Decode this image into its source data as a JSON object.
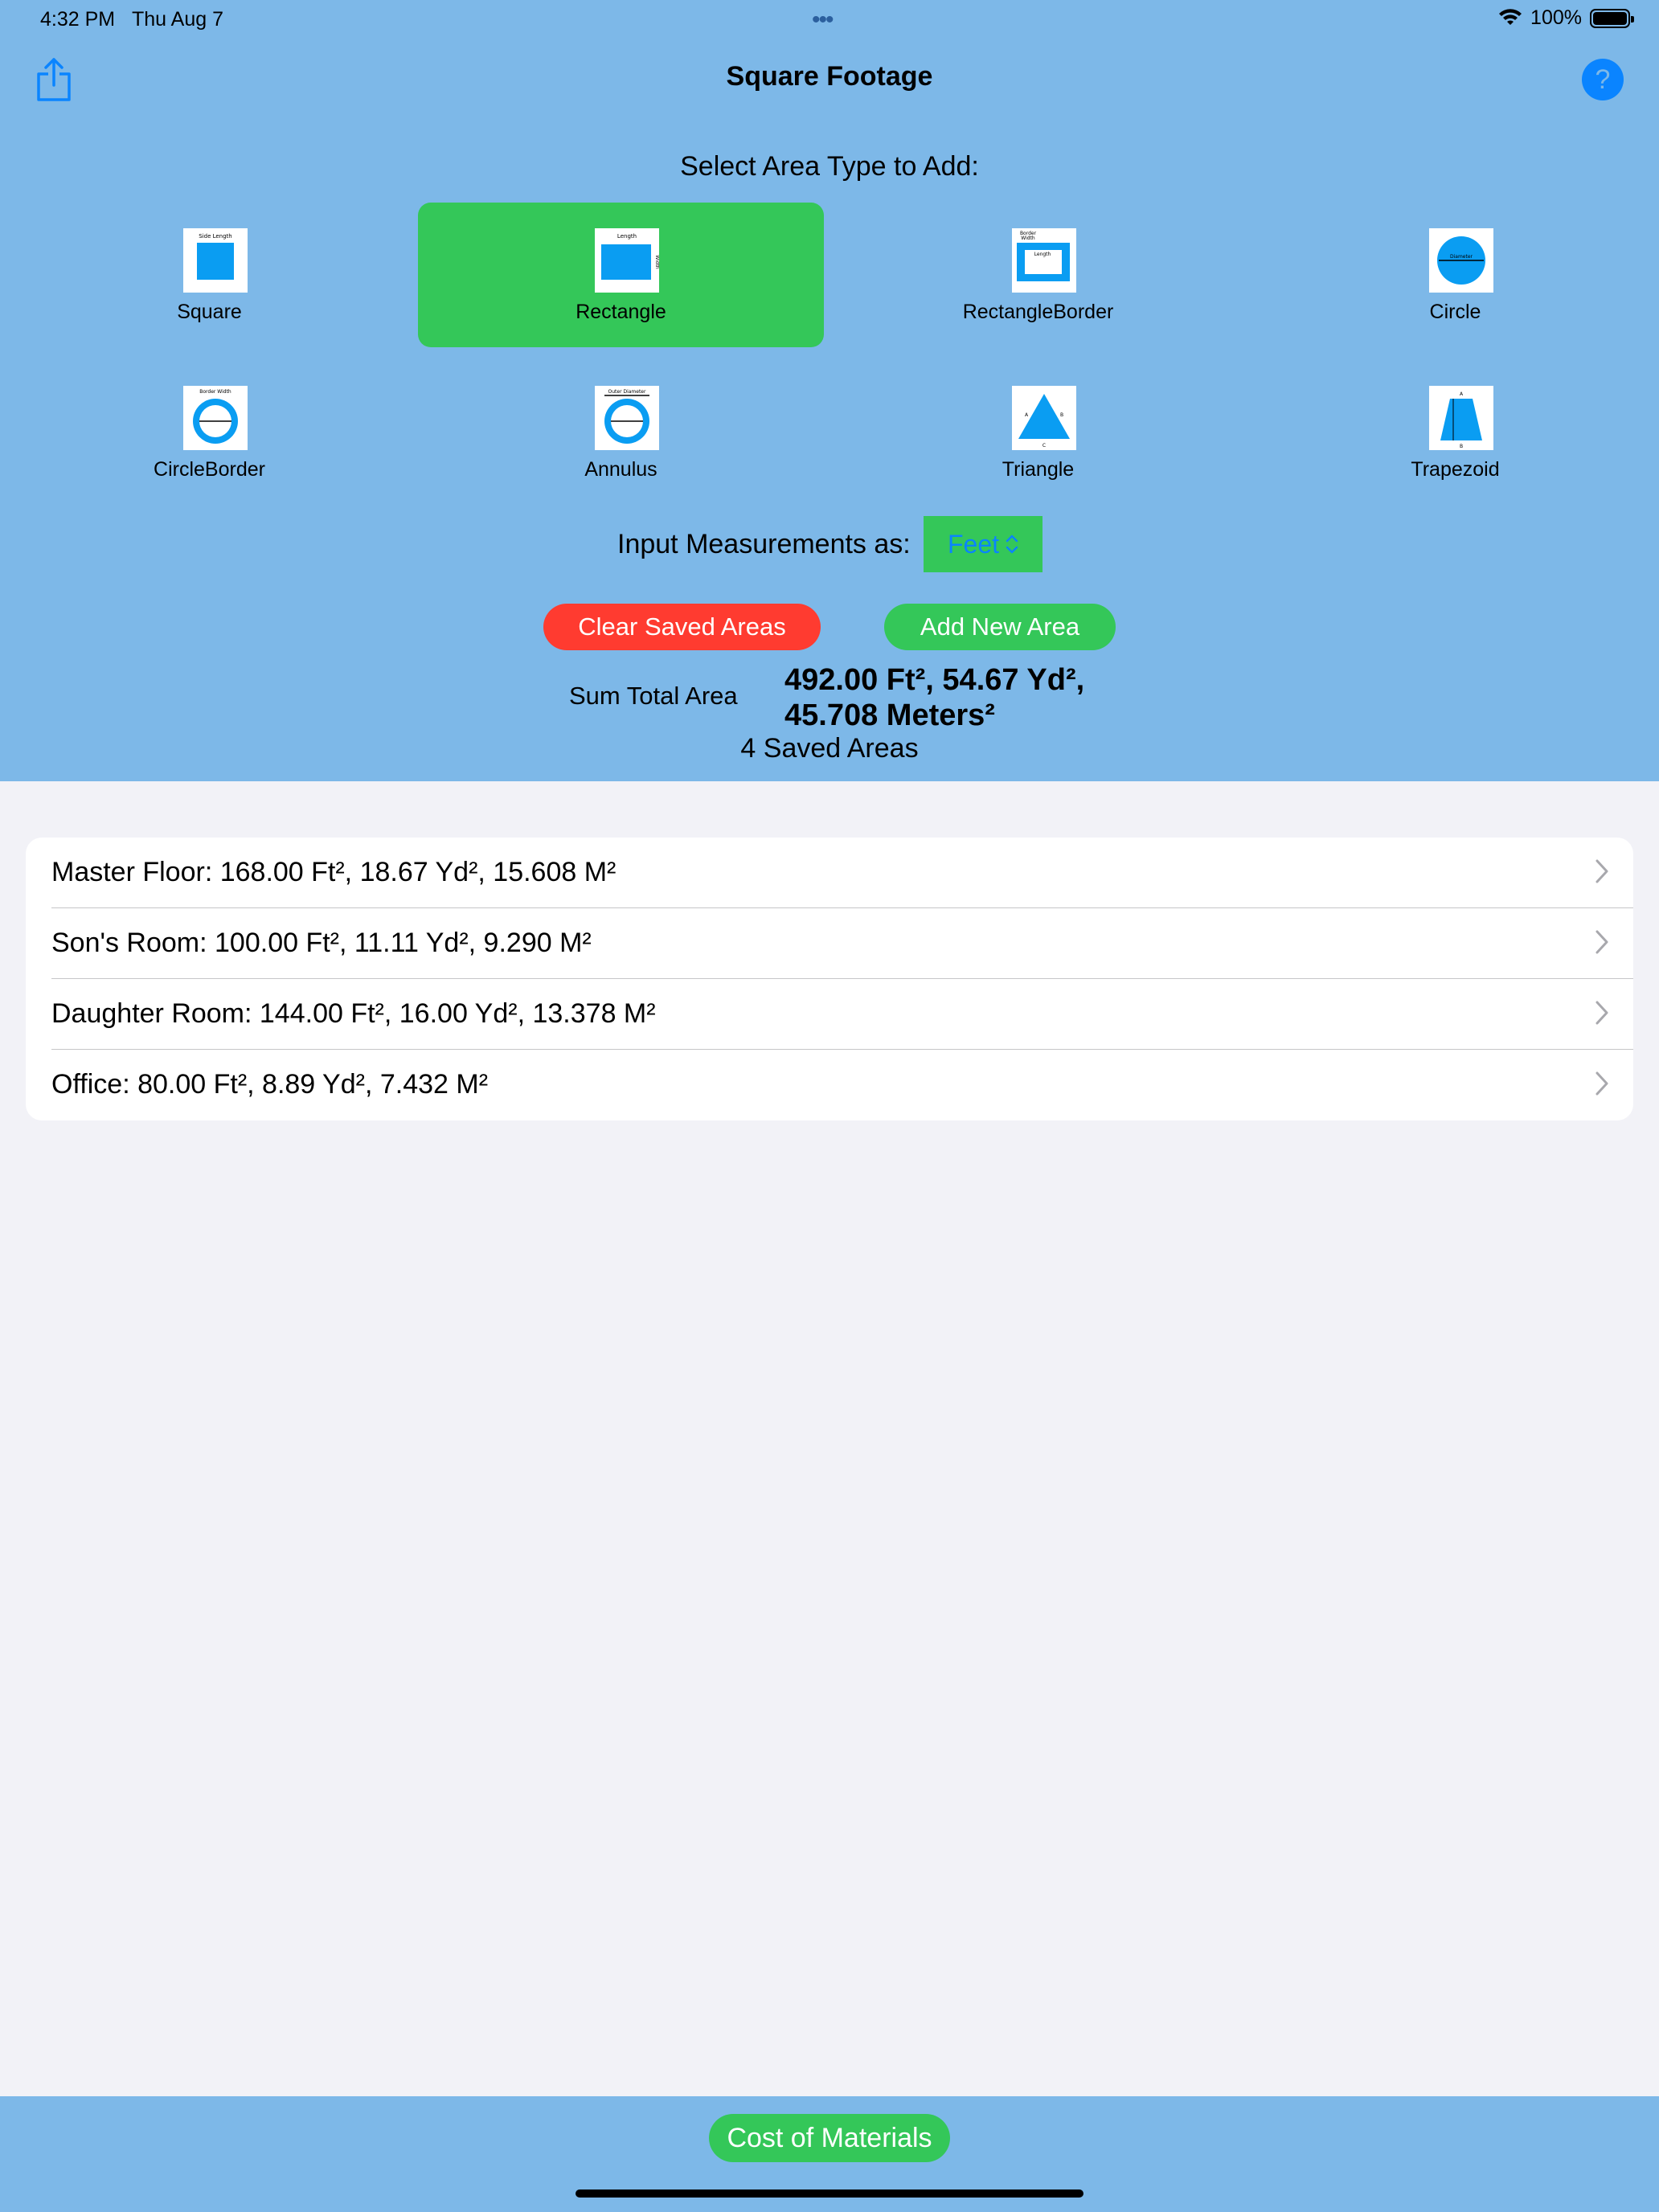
{
  "status_bar": {
    "time": "4:32 PM",
    "date": "Thu Aug 7",
    "dots": "•••",
    "battery": "100%"
  },
  "header": {
    "title": "Square Footage",
    "share_icon": "share-icon",
    "help_label": "?"
  },
  "area_types": {
    "heading": "Select Area Type to Add:",
    "selected": "Rectangle",
    "items": [
      {
        "label": "Square"
      },
      {
        "label": "Rectangle"
      },
      {
        "label": "RectangleBorder"
      },
      {
        "label": "Circle"
      },
      {
        "label": "CircleBorder"
      },
      {
        "label": "Annulus"
      },
      {
        "label": "Triangle"
      },
      {
        "label": "Trapezoid"
      }
    ]
  },
  "measurement": {
    "label": "Input Measurements as:",
    "unit": "Feet"
  },
  "actions": {
    "clear": "Clear Saved Areas",
    "add": "Add New Area"
  },
  "summary": {
    "label": "Sum Total Area",
    "line1": "492.00 Ft², 54.67 Yd²,",
    "line2": "45.708 Meters²",
    "count": "4 Saved Areas"
  },
  "saved_areas": [
    {
      "text": "Master Floor:  168.00 Ft², 18.67 Yd², 15.608 M²"
    },
    {
      "text": "Son's Room:  100.00 Ft², 11.11 Yd², 9.290 M²"
    },
    {
      "text": "Daughter Room:  144.00 Ft², 16.00 Yd², 13.378 M²"
    },
    {
      "text": "Office:  80.00 Ft², 8.89 Yd², 7.432 M²"
    }
  ],
  "footer": {
    "cost_button": "Cost of Materials"
  },
  "colors": {
    "panel": "#7db8e8",
    "green": "#34c759",
    "red": "#ff3b30",
    "blue": "#0a84ff",
    "shape": "#0a9df2"
  }
}
